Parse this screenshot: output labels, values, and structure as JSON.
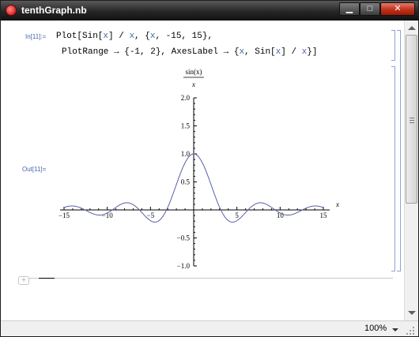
{
  "window": {
    "title": "tenthGraph.nb",
    "buttons": {
      "minimize": "▁",
      "maximize": "□",
      "close": "✕"
    }
  },
  "cell": {
    "in_label": "In[11]:=",
    "out_label": "Out[11]=",
    "code_line1": [
      {
        "t": "Plot[Sin[",
        "v": false
      },
      {
        "t": "x",
        "v": true
      },
      {
        "t": "] / ",
        "v": false
      },
      {
        "t": "x",
        "v": true
      },
      {
        "t": ", {",
        "v": false
      },
      {
        "t": "x",
        "v": true
      },
      {
        "t": ", -15, 15},",
        "v": false
      }
    ],
    "code_line2": [
      {
        "t": "PlotRange → {-1, 2}, AxesLabel → {",
        "v": false
      },
      {
        "t": "x",
        "v": true
      },
      {
        "t": ", Sin[",
        "v": false
      },
      {
        "t": "x",
        "v": true
      },
      {
        "t": "] / ",
        "v": false
      },
      {
        "t": "x",
        "v": true
      },
      {
        "t": "}]",
        "v": false
      }
    ]
  },
  "chart_data": {
    "type": "line",
    "function": "sin(x)/x",
    "xlabel": "x",
    "ylabel_numerator": "sin(x)",
    "ylabel_denominator": "x",
    "xlim": [
      -15,
      15
    ],
    "ylim": [
      -1,
      2
    ],
    "x_ticks": [
      -15,
      -10,
      -5,
      5,
      10,
      15
    ],
    "y_ticks": [
      -1.0,
      -0.5,
      0.5,
      1.0,
      1.5,
      2.0
    ],
    "y_tick_labels": [
      "−1.0",
      "−0.5",
      "0.5",
      "1.0",
      "1.5",
      "2.0"
    ],
    "x_tick_labels": [
      "−15",
      "−10",
      "−5",
      "5",
      "10",
      "15"
    ],
    "line_color": "#5a5fa8"
  },
  "status": {
    "zoom": "100%"
  }
}
